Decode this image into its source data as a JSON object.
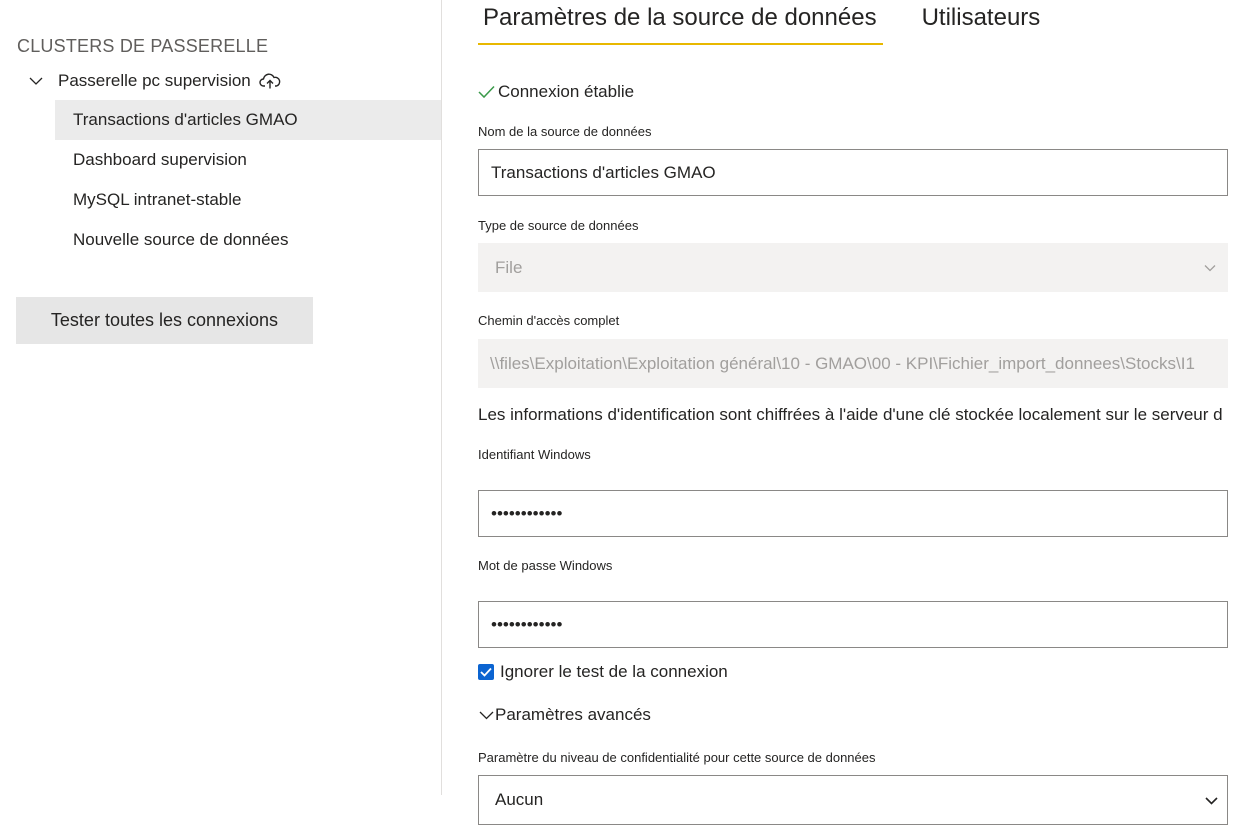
{
  "sidebar": {
    "title": "CLUSTERS DE PASSERELLE",
    "gateway": {
      "label": "Passerelle pc supervision",
      "icon": "cloud-upload-icon"
    },
    "items": [
      {
        "label": "Transactions d'articles GMAO",
        "selected": true
      },
      {
        "label": "Dashboard supervision",
        "selected": false
      },
      {
        "label": "MySQL intranet-stable",
        "selected": false
      },
      {
        "label": "Nouvelle source de données",
        "selected": false
      }
    ],
    "test_all_label": "Tester toutes les connexions"
  },
  "tabs": [
    {
      "label": "Paramètres de la source de données",
      "active": true
    },
    {
      "label": "Utilisateurs",
      "active": false
    }
  ],
  "form": {
    "status": "Connexion établie",
    "ds_name_label": "Nom de la source de données",
    "ds_name_value": "Transactions d'articles GMAO",
    "ds_type_label": "Type de source de données",
    "ds_type_value": "File",
    "path_label": "Chemin d'accès complet",
    "path_value": "\\\\files\\Exploitation\\Exploitation général\\10 - GMAO\\00 - KPI\\Fichier_import_donnees\\Stocks\\I1",
    "cred_info": "Les informations d'identification sont chiffrées à l'aide d'une clé stockée localement sur le serveur d",
    "windows_id_label": "Identifiant Windows",
    "windows_id_value": "••••••••••••",
    "windows_pwd_label": "Mot de passe Windows",
    "windows_pwd_value": "••••••••••••",
    "skip_test_label": "Ignorer le test de la connexion",
    "skip_test_checked": true,
    "advanced_label": "Paramètres avancés",
    "privacy_label": "Paramètre du niveau de confidentialité pour cette source de données",
    "privacy_value": "Aucun"
  },
  "colors": {
    "tab_underline": "#e8b800",
    "success_check": "#3a9a4a",
    "checkbox": "#0b64d1",
    "selected_item_bg": "#ebebeb"
  }
}
